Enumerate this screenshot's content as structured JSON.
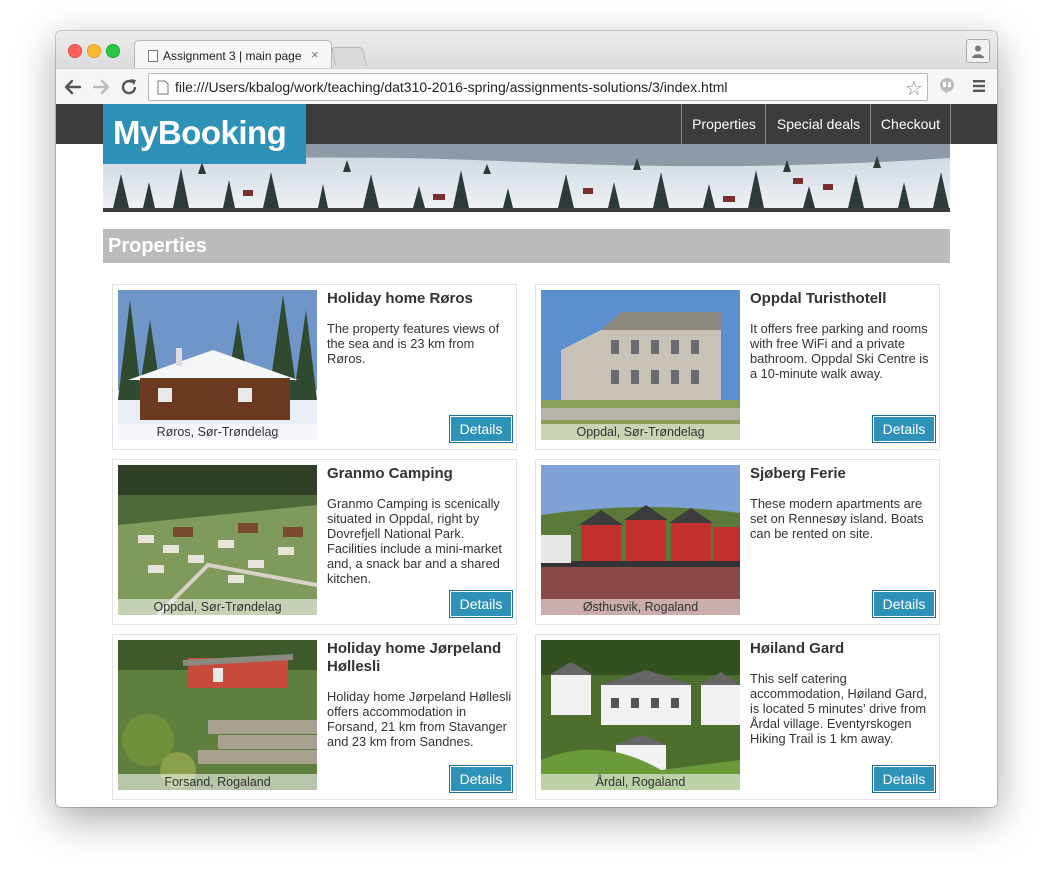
{
  "browser": {
    "tab_title": "Assignment 3 | main page",
    "tab_close": "×",
    "url": "file:///Users/kbalog/work/teaching/dat310-2016-spring/assignments-solutions/3/index.html"
  },
  "site": {
    "logo": "MyBooking",
    "nav": [
      "Properties",
      "Special deals",
      "Checkout"
    ],
    "section_title": "Properties",
    "details_label": "Details"
  },
  "properties": [
    {
      "title": "Holiday home Røros",
      "location": "Røros, Sør-Trøndelag",
      "description": "The property features views of the sea and is 23 km from Røros."
    },
    {
      "title": "Oppdal Turisthotell",
      "location": "Oppdal, Sør-Trøndelag",
      "description": "It offers free parking and rooms with free WiFi and a private bathroom. Oppdal Ski Centre is a 10-minute walk away."
    },
    {
      "title": "Granmo Camping",
      "location": "Oppdal, Sør-Trøndelag",
      "description": "Granmo Camping is scenically situated in Oppdal, right by Dovrefjell National Park. Facilities include a mini-market and, a snack bar and a shared kitchen."
    },
    {
      "title": "Sjøberg Ferie",
      "location": "Østhusvik, Rogaland",
      "description": "These modern apartments are set on Rennesøy island. Boats can be rented on site."
    },
    {
      "title": "Holiday home Jørpeland Høllesli",
      "location": "Forsand, Rogaland",
      "description": "Holiday home Jørpeland Høllesli offers accommodation in Forsand, 21 km from Stavanger and 23 km from Sandnes."
    },
    {
      "title": "Høiland Gard",
      "location": "Årdal, Rogaland",
      "description": "This self catering accommodation, Høiland Gard, is located 5 minutes' drive from Årdal village. Eventyrskogen Hiking Trail is 1 km away."
    }
  ],
  "colors": {
    "accent": "#2e92b8",
    "topbar": "#3c3c3c",
    "section": "#bbbbbb"
  }
}
